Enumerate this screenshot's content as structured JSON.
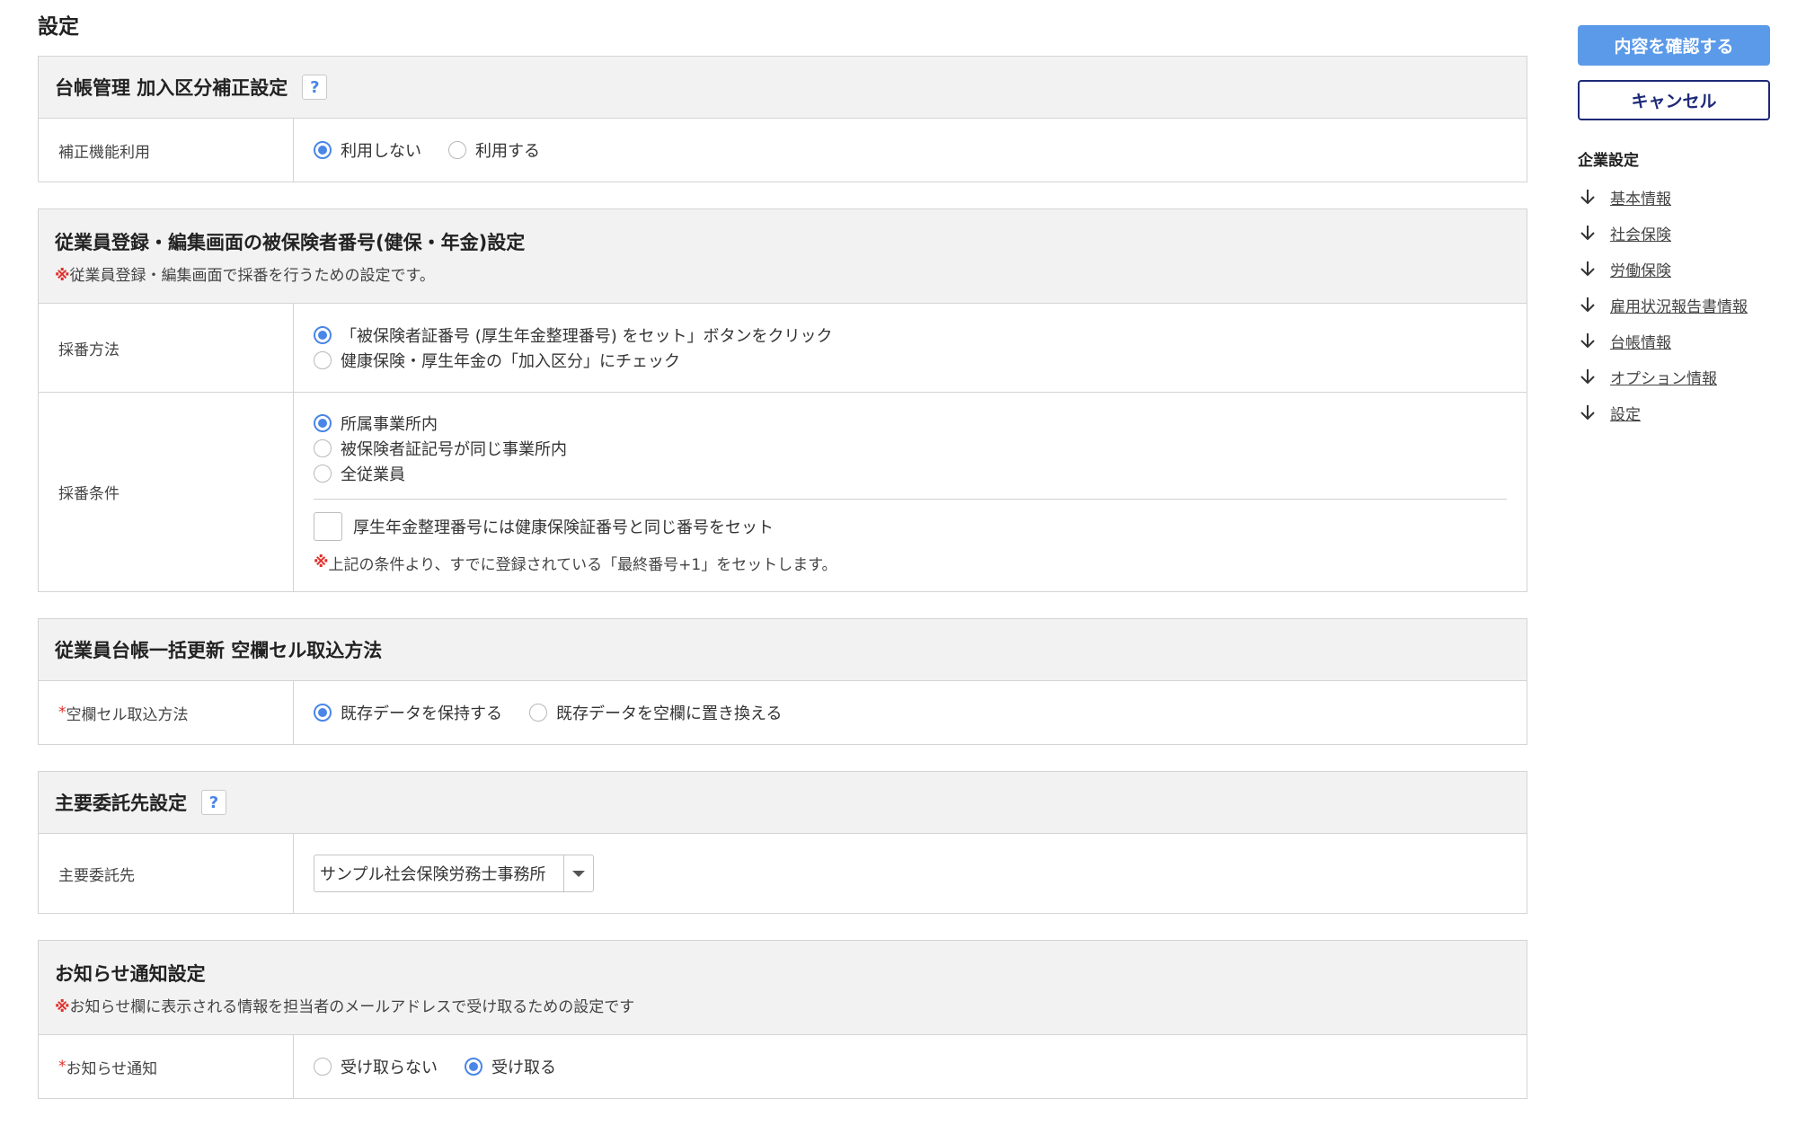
{
  "page": {
    "title": "設定"
  },
  "sections": {
    "ledger": {
      "title": "台帳管理 加入区分補正設定",
      "help": "?",
      "row_label": "補正機能利用",
      "options": [
        "利用しない",
        "利用する"
      ],
      "selected": "利用しない"
    },
    "insured": {
      "title": "従業員登録・編集画面の被保険者番号(健保・年金)設定",
      "note_mark": "※",
      "note": "従業員登録・編集画面で採番を行うための設定です。",
      "method_label": "採番方法",
      "method_options": [
        "「被保険者証番号 (厚生年金整理番号) をセット」ボタンをクリック",
        "健康保険・厚生年金の「加入区分」にチェック"
      ],
      "method_selected": "「被保険者証番号 (厚生年金整理番号) をセット」ボタンをクリック",
      "condition_label": "採番条件",
      "condition_options": [
        "所属事業所内",
        "被保険者証記号が同じ事業所内",
        "全従業員"
      ],
      "condition_selected": "所属事業所内",
      "checkbox_label": "厚生年金整理番号には健康保険証番号と同じ番号をセット",
      "checkbox_checked": false,
      "condition_note_mark": "※",
      "condition_note": "上記の条件より、すでに登録されている「最終番号+1」をセットします。"
    },
    "bulk": {
      "title": "従業員台帳一括更新 空欄セル取込方法",
      "required_mark": "*",
      "row_label": "空欄セル取込方法",
      "options": [
        "既存データを保持する",
        "既存データを空欄に置き換える"
      ],
      "selected": "既存データを保持する"
    },
    "consignee": {
      "title": "主要委託先設定",
      "help": "?",
      "row_label": "主要委託先",
      "select_value": "サンプル社会保険労務士事務所"
    },
    "notify": {
      "title": "お知らせ通知設定",
      "note_mark": "※",
      "note": "お知らせ欄に表示される情報を担当者のメールアドレスで受け取るための設定です",
      "required_mark": "*",
      "row_label": "お知らせ通知",
      "options": [
        "受け取らない",
        "受け取る"
      ],
      "selected": "受け取る"
    }
  },
  "sidebar": {
    "confirm_label": "内容を確認する",
    "cancel_label": "キャンセル",
    "nav_title": "企業設定",
    "nav_items": [
      "基本情報",
      "社会保険",
      "労働保険",
      "雇用状況報告書情報",
      "台帳情報",
      "オプション情報",
      "設定"
    ],
    "arrow_icon": "arrow-down-icon"
  },
  "colors": {
    "accent": "#4a86e8",
    "confirm_button": "#5b9ae8",
    "cancel_border": "#1e2a78",
    "header_bg": "#f2f2f2",
    "note_mark": "#e0302a"
  }
}
